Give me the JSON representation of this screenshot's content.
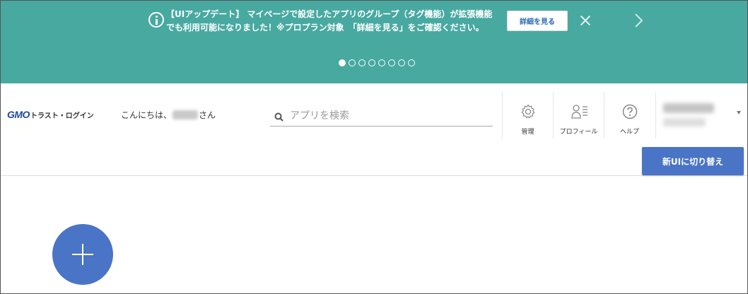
{
  "banner": {
    "line1": "【UIアップデート】 マイページで設定したアプリのグループ（タグ機能）が拡張機能",
    "line2": "でも利用可能になりました！※プロプラン対象　「詳細を見る」をご確認ください。",
    "details_button": "詳細を見る",
    "slide_count": 8,
    "active_slide": 1
  },
  "header": {
    "logo_mark": "GMO",
    "logo_text": "トラスト・ログイン",
    "greeting_prefix": "こんにちは、",
    "greeting_suffix": "さん",
    "search_placeholder": "アプリを検索",
    "nav": {
      "manage": "管理",
      "profile": "プロフィール",
      "help": "ヘルプ"
    },
    "new_ui_button": "新UIに切り替え"
  },
  "colors": {
    "banner_bg": "#48a9a1",
    "accent": "#4a74c6"
  }
}
